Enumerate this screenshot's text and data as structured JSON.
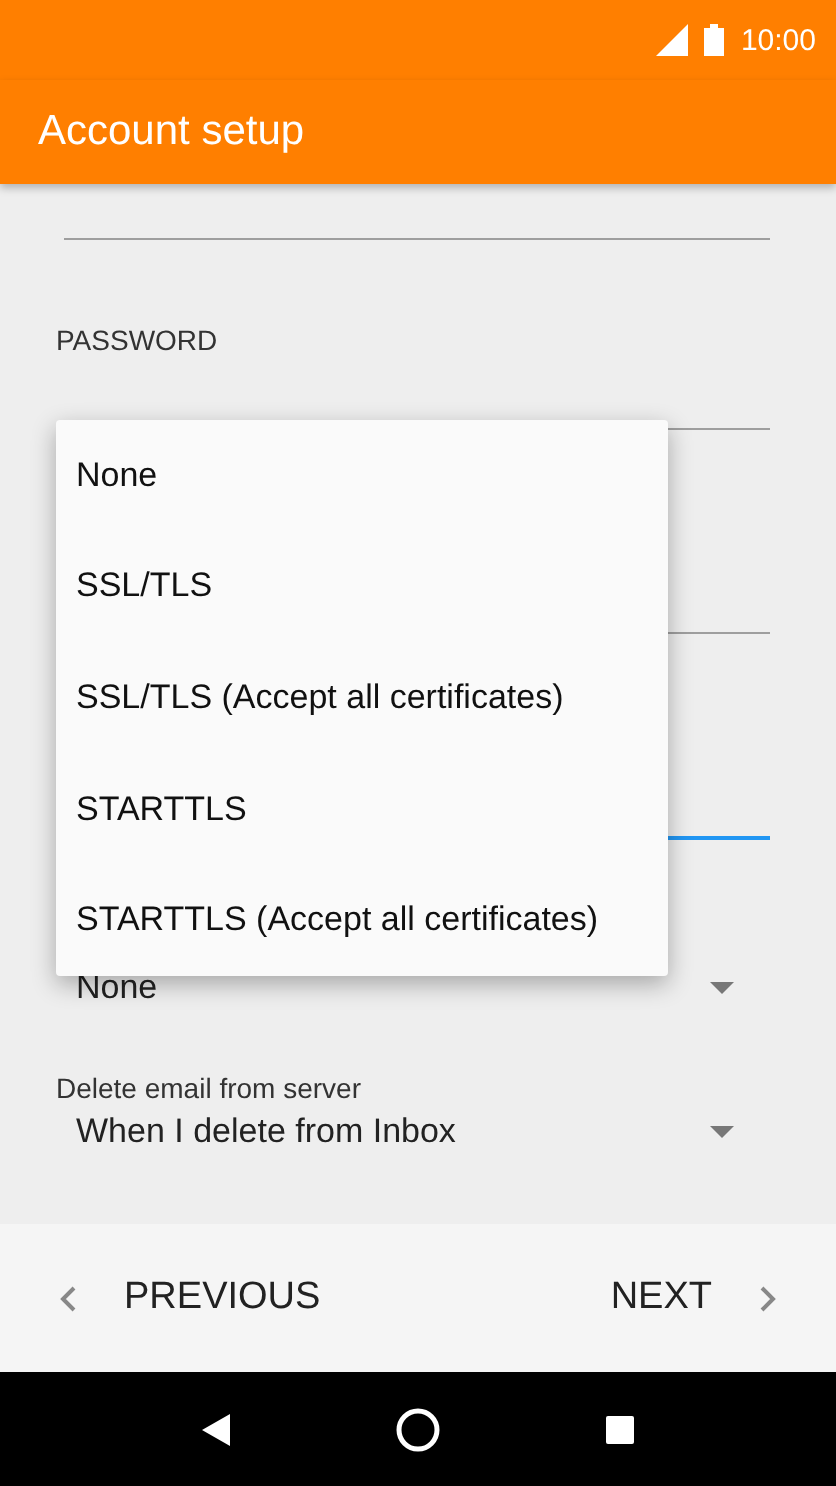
{
  "status_bar": {
    "time": "10:00"
  },
  "app_bar": {
    "title": "Account setup"
  },
  "form": {
    "password_label": "PASSWORD",
    "fields": [
      {
        "focused": false
      },
      {
        "focused": false
      },
      {
        "focused": true
      }
    ],
    "security_value": "None",
    "delete_label": "Delete email from server",
    "delete_value": "When I delete from Inbox"
  },
  "menu": {
    "items": [
      "None",
      "SSL/TLS",
      "SSL/TLS (Accept all certificates)",
      "STARTTLS",
      "STARTTLS (Accept all certificates)"
    ]
  },
  "footer": {
    "previous": "PREVIOUS",
    "next": "NEXT"
  }
}
